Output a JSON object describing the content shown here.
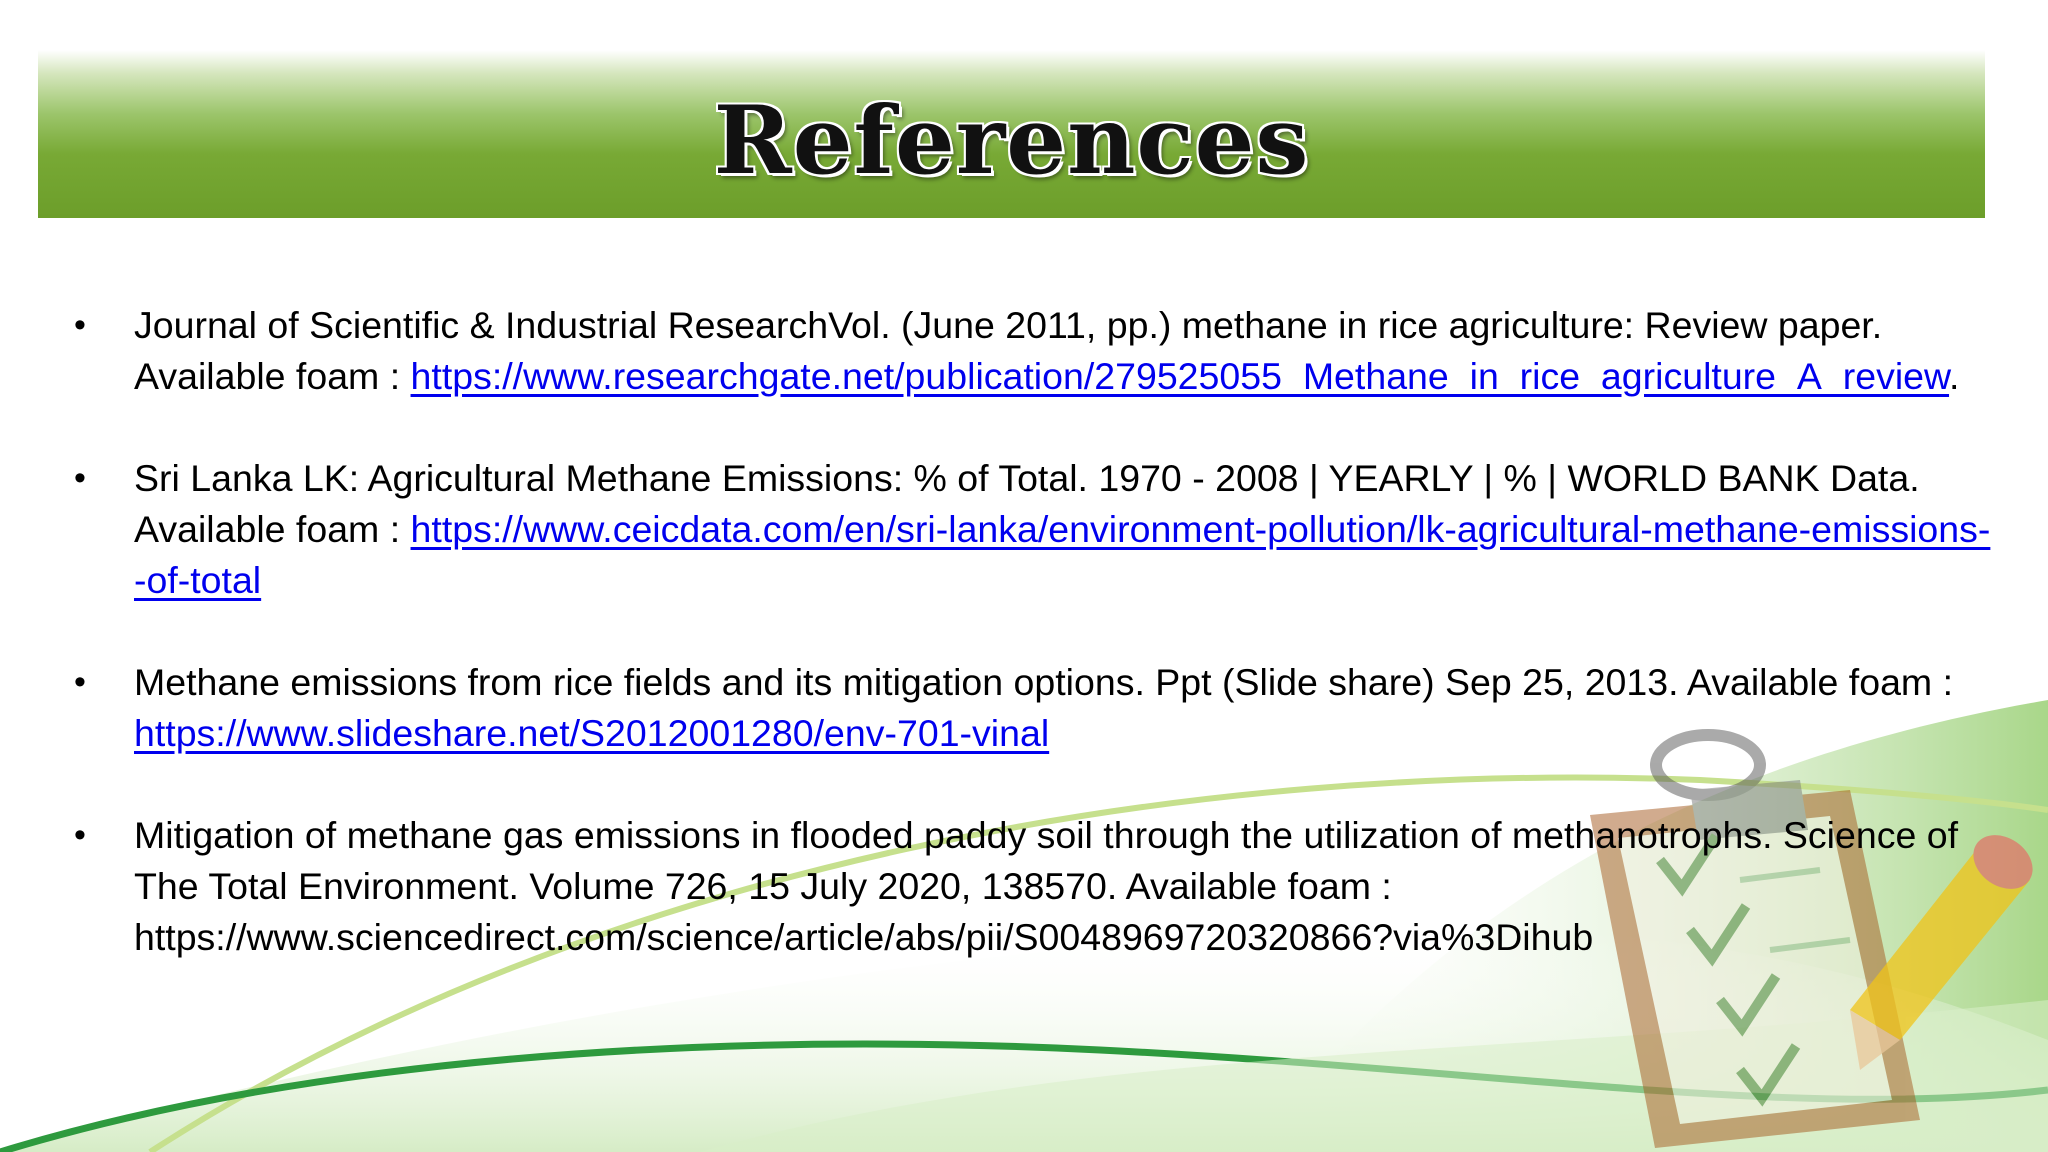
{
  "slide": {
    "title": "References",
    "references": [
      {
        "text": "Journal of Scientific & Industrial ResearchVol. (June 2011, pp.) methane  in rice  agriculture: Review paper. Available foam : ",
        "link": "https://www.researchgate.net/publication/279525055_Methane_in_rice_agriculture_A_review",
        "suffix": "."
      },
      {
        "text": "Sri Lanka LK: Agricultural Methane Emissions: % of Total. 1970 - 2008 | YEARLY | % | WORLD BANK Data. Available foam : ",
        "link": "https://www.ceicdata.com/en/sri-lanka/environment-pollution/lk-agricultural-methane-emissions--of-total",
        "suffix": ""
      },
      {
        "text": "Methane emissions from rice fields and its mitigation options. Ppt (Slide share) Sep 25, 2013. Available foam : ",
        "link": "https://www.slideshare.net/S2012001280/env-701-vinal",
        "suffix": ""
      },
      {
        "text": "Mitigation of methane gas emissions in flooded paddy soil through the utilization of methanotrophs. Science of The Total Environment. Volume 726, 15 July 2020, 138570. Available foam : https://www.sciencedirect.com/science/article/abs/pii/S0048969720320866?via%3Dihub",
        "link": "",
        "suffix": ""
      }
    ],
    "bullet_char": "•"
  },
  "colors": {
    "title_band": "#6c9e2a",
    "link": "#0000ee",
    "wave_dark": "#2e9a3e",
    "wave_light": "#bfe0a0"
  },
  "icons": [
    "clipboard-checklist-icon",
    "pencil-icon"
  ]
}
